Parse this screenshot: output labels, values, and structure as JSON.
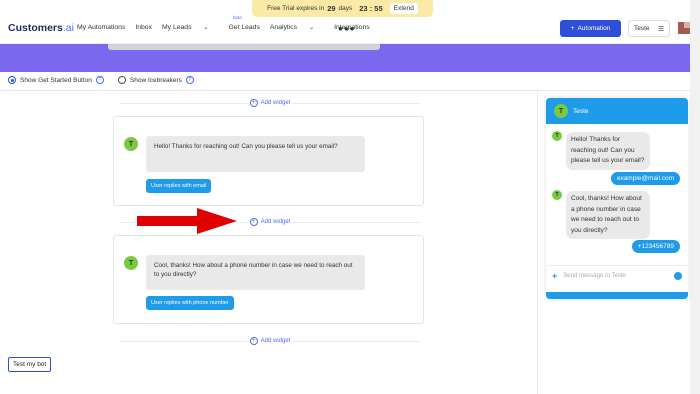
{
  "trial": {
    "prefix": "Free Trial expires in",
    "days_num": "29",
    "days_label": "days",
    "time": "23 : 55",
    "extend": "Extend"
  },
  "header": {
    "logo_main": "Customers",
    "logo_suffix": ".ai",
    "nav": [
      "My Automations",
      "Inbox",
      "My Leads",
      "Get Leads",
      "Analytics",
      "Integrations"
    ],
    "beta": "beta",
    "automation_button": "Automation",
    "account": "Teste"
  },
  "options": {
    "show_started": "Show Get Started Button",
    "show_icebreakers": "Show Icebreakers",
    "selected": "show_started"
  },
  "editor": {
    "add_widget": "Add widget",
    "widget1": {
      "avatar": "T",
      "message": "Hello! Thanks for reaching out! Can you please tell us your email?",
      "button": "User replies with email"
    },
    "widget2": {
      "avatar": "T",
      "message": "Cool, thanks! How about a phone number in case we need to reach out to you directly?",
      "button": "User replies with phone number"
    },
    "test_bot": "Test my bot"
  },
  "chat": {
    "title": "Teste",
    "avatar": "T",
    "msg1": "Hello! Thanks for reaching out! Can you please tell us your email?",
    "reply1": "example@mail.com",
    "msg2": "Cool, thanks! How about a phone number in case we need to reach out to you directly?",
    "reply2": "+123456789",
    "input_placeholder": "Send message to Teste"
  },
  "colors": {
    "accent": "#2f4fd8",
    "purple": "#7b68ee",
    "chat_blue": "#1e9be9",
    "avatar_green": "#7ac943",
    "arrow": "#e00000"
  }
}
